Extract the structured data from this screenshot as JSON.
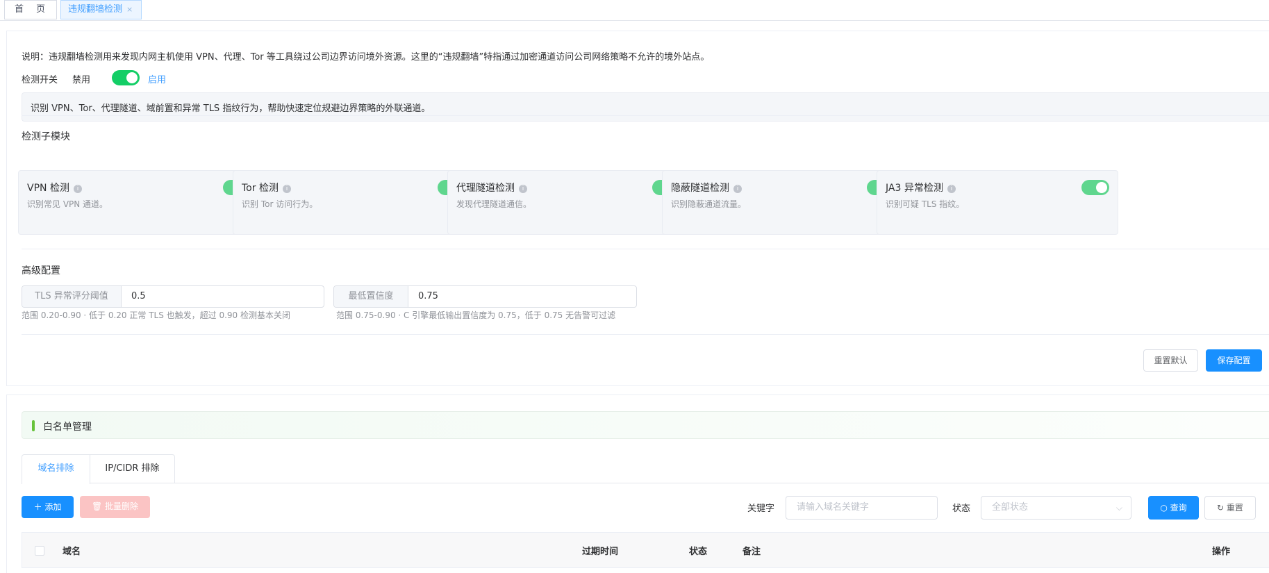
{
  "tabs": {
    "home": "首页",
    "active": "违规翻墙检测",
    "close": "×"
  },
  "config": {
    "description": "说明：违规翻墙检测用来发现内网主机使用 VPN、代理、Tor 等工具绕过公司边界访问境外资源。这里的“违规翻墙”特指通过加密通道访问公司网络策略不允许的境外站点。",
    "switch_label": "检测开关",
    "switch_off": "禁用",
    "switch_on": "启用",
    "switch_state": true,
    "info": "识别 VPN、Tor、代理隧道、域前置和异常 TLS 指纹行为，帮助快速定位规避边界策略的外联通道。",
    "modules_title": "检测子模块",
    "modules": [
      {
        "title": "VPN 检测",
        "desc": "识别常见 VPN 通道。",
        "enabled": true
      },
      {
        "title": "Tor 检测",
        "desc": "识别 Tor 访问行为。",
        "enabled": true
      },
      {
        "title": "代理隧道检测",
        "desc": "发现代理隧道通信。",
        "enabled": true
      },
      {
        "title": "隐蔽隧道检测",
        "desc": "识别隐蔽通道流量。",
        "enabled": true
      },
      {
        "title": "JA3 异常检测",
        "desc": "识别可疑 TLS 指纹。",
        "enabled": true
      }
    ],
    "advanced_title": "高级配置",
    "tls_label": "TLS 异常评分阈值",
    "tls_value": "0.5",
    "tls_hint": "范围 0.20-0.90 · 低于 0.20 正常 TLS 也触发，超过 0.90 检测基本关闭",
    "conf_label": "最低置信度",
    "conf_value": "0.75",
    "conf_hint": "范围 0.75-0.90 · C 引擎最低输出置信度为 0.75，低于 0.75 无告警可过滤",
    "reset_label": "重置默认",
    "save_label": "保存配置"
  },
  "whitelist": {
    "title": "白名单管理",
    "tab_domain": "域名排除",
    "tab_ip": "IP/CIDR 排除",
    "add_label": "添加",
    "batch_delete_label": "批量删除",
    "keyword_label": "关键字",
    "keyword_placeholder": "请输入域名关键字",
    "status_label": "状态",
    "status_value": "全部状态",
    "query_label": "查询",
    "reset_label": "重置",
    "columns": {
      "domain": "域名",
      "expire": "过期时间",
      "status": "状态",
      "remark": "备注",
      "action": "操作"
    }
  },
  "colors": {
    "primary": "#1890ff",
    "switch_on": "#13ce66",
    "accent_green": "#67c23a"
  }
}
